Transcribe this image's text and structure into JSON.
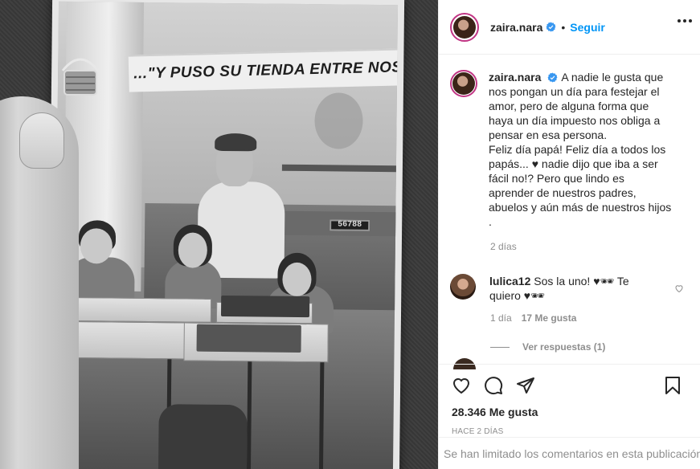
{
  "photo": {
    "banner_text": "...\"Y PUSO SU TIENDA ENTRE NOSO",
    "counter_text": "56788"
  },
  "header": {
    "username": "zaira.nara",
    "verified_icon": "verified-badge-icon",
    "separator": "•",
    "follow_label": "Seguir",
    "more_icon": "more-options-icon"
  },
  "caption": {
    "username": "zaira.nara",
    "text": "A nadie le gusta que nos pongan un día para festejar el amor, pero de alguna forma que haya un día impuesto nos obliga a pensar en esa persona.\nFeliz día papá! Feliz día a todos los papás... ♥ nadie dijo que iba a ser fácil no!? Pero que lindo es aprender de nuestros padres, abuelos y aún más de nuestros hijos .",
    "time": "2 días"
  },
  "comments": [
    {
      "username": "lulica12",
      "text": "Sos la uno! ♥🕶 Te quiero ♥🕶",
      "time": "1 día",
      "likes": "17 Me gusta",
      "replies_label": "Ver respuestas (1)"
    }
  ],
  "actions": {
    "like_icon": "heart-icon",
    "comment_icon": "comment-icon",
    "share_icon": "paper-plane-icon",
    "save_icon": "bookmark-icon",
    "likes_text": "28.346 Me gusta",
    "date_text": "HACE 2 DÍAS",
    "comments_limited_text": "Se han limitado los comentarios en esta publicación"
  },
  "colors": {
    "accent": "#0095f6",
    "text": "#262626",
    "muted": "#8e8e8e",
    "border": "#efefef"
  }
}
